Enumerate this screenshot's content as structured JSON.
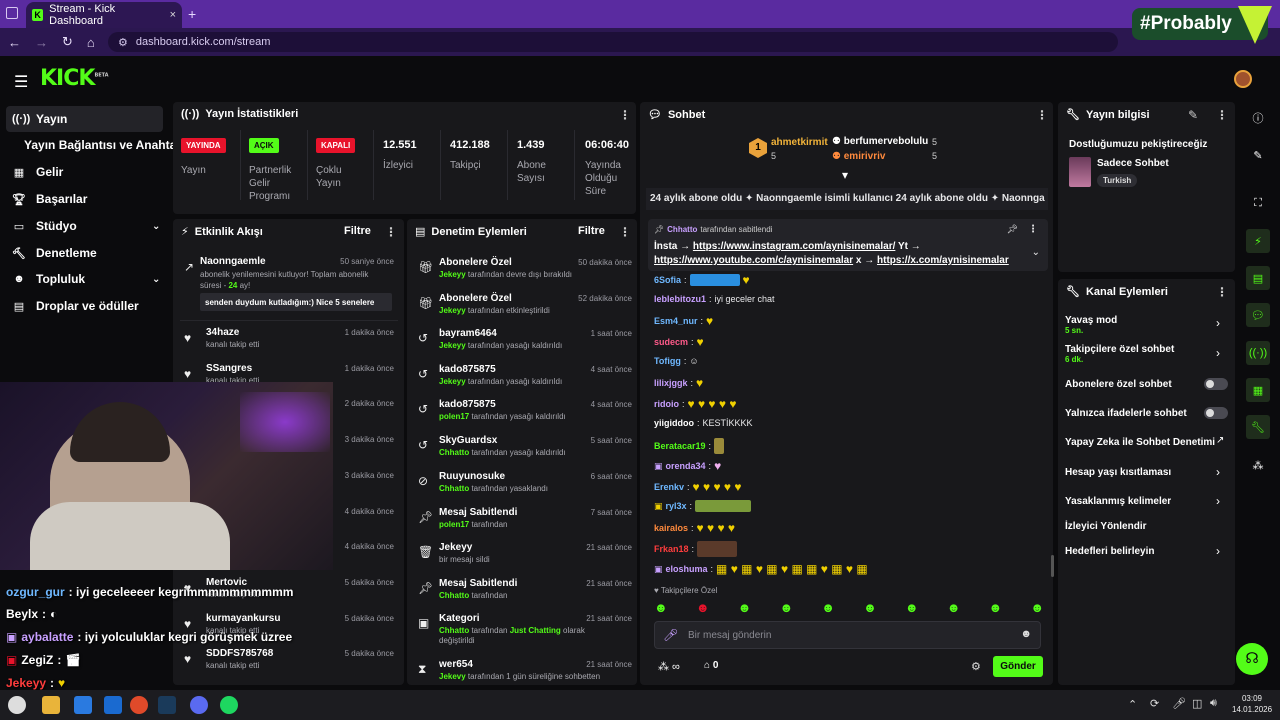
{
  "browser": {
    "tab_title": "Stream - Kick Dashboard",
    "url": "dashboard.kick.com/stream",
    "new_tab": "+",
    "close": "×"
  },
  "overlay_logo": "#Probably",
  "kick": {
    "logo": "KICK",
    "beta": "BETA"
  },
  "sidebar": {
    "items": [
      {
        "label": "Yayın",
        "icon": "broadcast-icon"
      },
      {
        "label": "Yayın Bağlantısı ve Anahtarı",
        "icon": "key-icon"
      },
      {
        "label": "Gelir",
        "icon": "revenue-icon"
      },
      {
        "label": "Başarılar",
        "icon": "trophy-icon"
      },
      {
        "label": "Stüdyo",
        "icon": "studio-icon"
      },
      {
        "label": "Denetleme",
        "icon": "hammer-icon"
      },
      {
        "label": "Topluluk",
        "icon": "community-icon"
      },
      {
        "label": "Droplar ve ödüller",
        "icon": "drops-icon"
      }
    ]
  },
  "stats": {
    "title": "Yayın İstatistikleri",
    "status": [
      {
        "badge": "YAYINDA",
        "label": "Yayın"
      },
      {
        "badge": "AÇIK",
        "label": "Partnerlik Gelir Programı"
      },
      {
        "badge": "KAPALI",
        "label": "Çoklu Yayın"
      }
    ],
    "metrics": [
      {
        "value": "12.551",
        "label": "İzleyici"
      },
      {
        "value": "412.188",
        "label": "Takipçi"
      },
      {
        "value": "1.439",
        "label": "Abone Sayısı"
      },
      {
        "value": "06:06:40",
        "label": "Yayında Olduğu Süre"
      }
    ]
  },
  "activity": {
    "title": "Etkinlik Akışı",
    "filter": "Filtre",
    "pinned": {
      "name": "Naonngaemle",
      "time": "50 saniye önce",
      "text": "abonelik yenilemesini kutluyor! Toplam abonelik süresi - ",
      "months": "24",
      "months_suffix": " ay!",
      "message": "senden duydum kutladığım:) Nice 5 senelere"
    },
    "items": [
      {
        "name": "34haze",
        "time": "1 dakika önce",
        "sub": "kanalı takip etti"
      },
      {
        "name": "SSangres",
        "time": "1 dakika önce",
        "sub": "kanalı takip etti"
      },
      {
        "name": "",
        "time": "2 dakika önce",
        "sub": ""
      },
      {
        "name": "",
        "time": "3 dakika önce",
        "sub": ""
      },
      {
        "name": "",
        "time": "3 dakika önce",
        "sub": ""
      },
      {
        "name": "",
        "time": "4 dakika önce",
        "sub": ""
      },
      {
        "name": "",
        "time": "4 dakika önce",
        "sub": ""
      },
      {
        "name": "Mertovic",
        "time": "5 dakika önce",
        "sub": "kanalı takip etti"
      },
      {
        "name": "kurmayankursu",
        "time": "5 dakika önce",
        "sub": "kanalı takip etti"
      },
      {
        "name": "SDDFS785768",
        "time": "5 dakika önce",
        "sub": "kanalı takip etti"
      }
    ]
  },
  "moderation": {
    "title": "Denetim Eylemleri",
    "filter": "Filtre",
    "items": [
      {
        "name": "Abonelere Özel",
        "time": "50 dakika önce",
        "actor": "Jekeyy",
        "action": " tarafından devre dışı bırakıldı"
      },
      {
        "name": "Abonelere Özel",
        "time": "52 dakika önce",
        "actor": "Jekeyy",
        "action": " tarafından etkinleştirildi"
      },
      {
        "name": "bayram6464",
        "time": "1 saat önce",
        "actor": "Jekeyy",
        "action": " tarafından yasağı kaldırıldı"
      },
      {
        "name": "kado875875",
        "time": "4 saat önce",
        "actor": "Jekeyy",
        "action": " tarafından yasağı kaldırıldı"
      },
      {
        "name": "kado875875",
        "time": "4 saat önce",
        "actor": "polen17",
        "action": " tarafından yasağı kaldırıldı"
      },
      {
        "name": "SkyGuardsx",
        "time": "5 saat önce",
        "actor": "Chhatto",
        "action": " tarafından yasağı kaldırıldı"
      },
      {
        "name": "Ruuyunosuke",
        "time": "6 saat önce",
        "actor": "Chhatto",
        "action": " tarafından yasaklandı"
      },
      {
        "name": "Mesaj Sabitlendi",
        "time": "7 saat önce",
        "actor": "polen17",
        "action": " tarafından"
      },
      {
        "name": "Jekeyy",
        "time": "21 saat önce",
        "actor": "",
        "action": "bir mesajı sildi"
      },
      {
        "name": "Mesaj Sabitlendi",
        "time": "21 saat önce",
        "actor": "Chhatto",
        "action": " tarafından"
      },
      {
        "name": "Kategori",
        "time": "21 saat önce",
        "actor": "Chhatto",
        "action": " tarafından ",
        "extra": "Just Chatting",
        "extra2": " olarak değiştirildi"
      },
      {
        "name": "wer654",
        "time": "21 saat önce",
        "actor": "Jekevy",
        "action": " tarafından 1 gün süreliğine sohbetten"
      }
    ]
  },
  "chat": {
    "title": "Sohbet",
    "leaders": [
      {
        "rank": "1",
        "name": "ahmetkirmit",
        "count": "5"
      },
      {
        "name": "berfumervebolulu",
        "count": "5"
      },
      {
        "name": "emirivriv",
        "count": "5"
      }
    ],
    "ticker": "24 aylık abone oldu  ✦  Naonngaemle isimli kullanıcı 24 aylık abone oldu  ✦  Naonnga",
    "pinned": {
      "by": "Chhatto",
      "by_suffix": " tarafından sabitlendi",
      "text": "İnsta → ",
      "link1": "https://www.instagram.com/aynisinemalar/",
      "yt": " Yt → ",
      "link2": "https://www.youtube.com/c/aynisinemalar",
      "x": " x → ",
      "link3": "https://x.com/aynisinemalar"
    },
    "messages": [
      {
        "user": "6Sofia",
        "color": "#6fb8ff",
        "text": ""
      },
      {
        "user": "leblebitozu1",
        "color": "#c8a0ff",
        "text": "iyi geceler chat"
      },
      {
        "user": "Esm4_nur",
        "color": "#6fb8ff",
        "text": ""
      },
      {
        "user": "sudecm",
        "color": "#ff5a8a",
        "text": ""
      },
      {
        "user": "Tofigg",
        "color": "#6fb8ff",
        "text": ""
      },
      {
        "user": "lilixjggk",
        "color": "#c8a0ff",
        "text": ""
      },
      {
        "user": "ridoio",
        "color": "#c8a0ff",
        "text": ""
      },
      {
        "user": "yiigiddoo",
        "color": "#ffffff",
        "text": "KESTİKKKK"
      },
      {
        "user": "Beratacar19",
        "color": "#53fc18",
        "text": ""
      },
      {
        "user": "orenda34",
        "color": "#c8a0ff",
        "text": ""
      },
      {
        "user": "Erenkv",
        "color": "#6fb8ff",
        "text": ""
      },
      {
        "user": "ryl3x",
        "color": "#6fb8ff",
        "text": ""
      },
      {
        "user": "kairalos",
        "color": "#ff8a3d",
        "text": ""
      },
      {
        "user": "Frkan18",
        "color": "#ff3d3d",
        "text": ""
      },
      {
        "user": "eloshuma",
        "color": "#c8a0ff",
        "text": ""
      }
    ],
    "followers_only": "Takipçilere Özel",
    "input_placeholder": "Bir mesaj gönderin",
    "points": "0",
    "send": "Gönder"
  },
  "stream_info": {
    "title": "Yayın bilgisi",
    "stream_title": "Dostluğumuzu pekiştireceğiz",
    "category": "Sadece Sohbet",
    "tag": "Turkish"
  },
  "channel_actions": {
    "title": "Kanal Eylemleri",
    "items": [
      {
        "label": "Yavaş mod",
        "sub": "5 sn.",
        "control": "chevron"
      },
      {
        "label": "Takipçilere özel sohbet",
        "sub": "6 dk.",
        "control": "chevron"
      },
      {
        "label": "Abonelere özel sohbet",
        "sub": "",
        "control": "toggle"
      },
      {
        "label": "Yalnızca ifadelerle sohbet",
        "sub": "",
        "control": "toggle"
      },
      {
        "label": "Yapay Zeka ile Sohbet Denetimi",
        "sub": "",
        "control": "external"
      },
      {
        "label": "Hesap yaşı kısıtlaması",
        "sub": "",
        "control": "chevron"
      },
      {
        "label": "Yasaklanmış kelimeler",
        "sub": "",
        "control": "chevron"
      },
      {
        "label": "İzleyici Yönlendir",
        "sub": "",
        "control": "none"
      },
      {
        "label": "Hedefleri belirleyin",
        "sub": "",
        "control": "chevron"
      }
    ]
  },
  "overlay_chat": [
    {
      "user": "ozgur_gur",
      "text": " : iyi geceleeeer kegrimmmmmmmmmm",
      "color": "#6fb8ff"
    },
    {
      "user": "Beylx",
      "text": " : ",
      "color": "#ffffff"
    },
    {
      "user": "aybalatte",
      "text": " : iyi yolculuklar kegri görüşmek üzree",
      "color": "#c8a0ff"
    },
    {
      "user": "ZegiZ",
      "text": " : ",
      "color": "#ffffff"
    },
    {
      "user": "Jekeyy",
      "text": " : ",
      "color": "#ff3d3d"
    }
  ],
  "taskbar": {
    "time": "03:09",
    "date": "14.01.2026"
  },
  "colors": {
    "kick_green": "#53fc18",
    "panel": "#18181b",
    "bg": "#0b0b0d",
    "live_red": "#e8132b"
  }
}
